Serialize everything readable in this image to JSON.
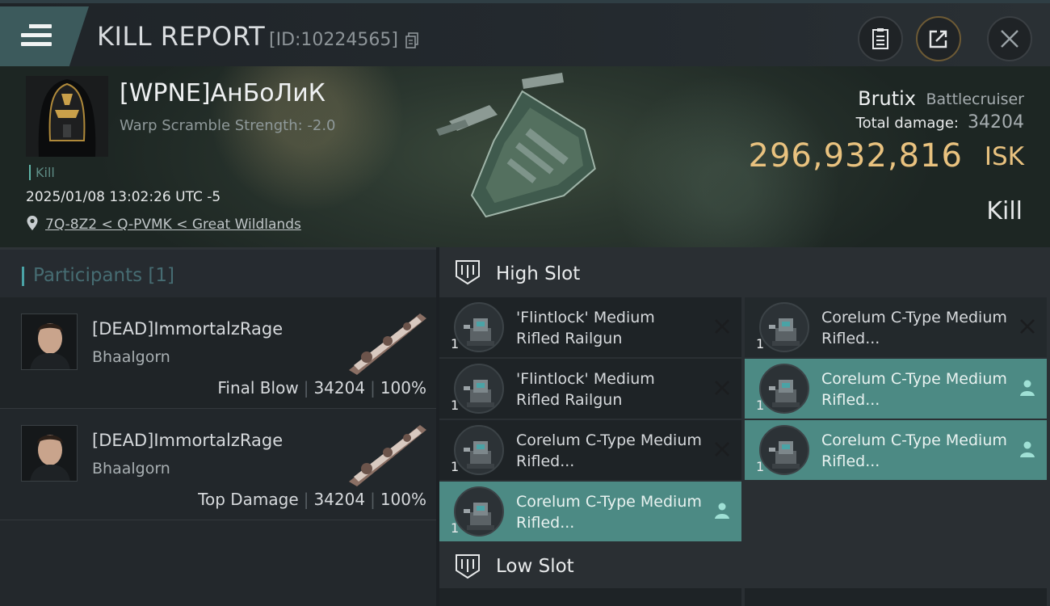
{
  "header": {
    "title": "KILL REPORT",
    "report_id": "[ID:10224565]"
  },
  "victim": {
    "name": "[WPNE]АнБоЛиК",
    "warp_scramble": "Warp Scramble Strength: -2.0",
    "tag": "Kill",
    "datetime": "2025/01/08 13:02:26 UTC -5",
    "location": "7Q-8Z2 < Q-PVMK < Great Wildlands"
  },
  "ship": {
    "name": "Brutix",
    "class": "Battlecruiser",
    "damage_label": "Total damage:",
    "damage_value": "34204",
    "isk_value": "296,932,816",
    "isk_unit": "ISK",
    "result": "Kill"
  },
  "participants": {
    "title": "Participants [1]",
    "rows": [
      {
        "name": "[DEAD]ImmortalzRage",
        "ship": "Bhaalgorn",
        "role": "Final Blow",
        "damage": "34204",
        "percent": "100%"
      },
      {
        "name": "[DEAD]ImmortalzRage",
        "ship": "Bhaalgorn",
        "role": "Top Damage",
        "damage": "34204",
        "percent": "100%"
      }
    ]
  },
  "fitting": {
    "high_slot_title": "High Slot",
    "low_slot_title": "Low Slot",
    "high_modules": [
      {
        "name": "'Flintlock' Medium Rifled Railgun",
        "qty": "1",
        "state": "destroyed"
      },
      {
        "name": "Corelum C-Type Medium Rifled...",
        "qty": "1",
        "state": "destroyed"
      },
      {
        "name": "'Flintlock' Medium Rifled Railgun",
        "qty": "1",
        "state": "destroyed"
      },
      {
        "name": "Corelum C-Type Medium Rifled...",
        "qty": "1",
        "state": "dropped"
      },
      {
        "name": "Corelum C-Type Medium Rifled...",
        "qty": "1",
        "state": "destroyed"
      },
      {
        "name": "Corelum C-Type Medium Rifled...",
        "qty": "1",
        "state": "dropped"
      },
      {
        "name": "Corelum C-Type Medium Rifled...",
        "qty": "1",
        "state": "dropped"
      }
    ]
  },
  "colors": {
    "accent_teal": "#4c8a84",
    "isk_gold": "#e9c27f",
    "menu_teal": "#3c5a5c"
  }
}
